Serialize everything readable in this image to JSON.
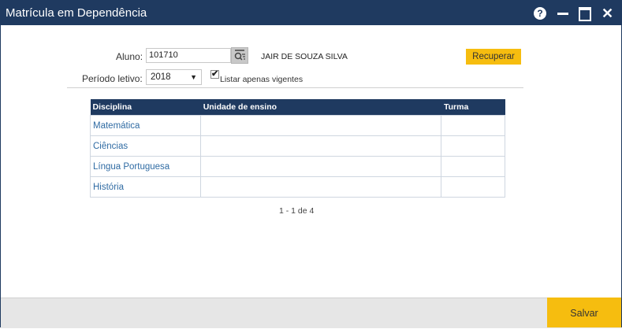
{
  "window": {
    "title": "Matrícula em Dependência",
    "controls": {
      "help": "?",
      "close": "✕"
    }
  },
  "form": {
    "aluno_label": "Aluno:",
    "aluno_value": "101710",
    "student_name": "JAIR DE SOUZA SILVA",
    "recuperar_label": "Recuperar",
    "periodo_label": "Período letivo:",
    "periodo_value": "2018",
    "listar_checked": true,
    "listar_label": "Listar apenas vigentes"
  },
  "table": {
    "headers": [
      "Disciplina",
      "Unidade de ensino",
      "Turma"
    ],
    "rows": [
      {
        "disciplina": "Matemática",
        "unidade": "",
        "turma": ""
      },
      {
        "disciplina": "Ciências",
        "unidade": "",
        "turma": ""
      },
      {
        "disciplina": "Língua Portuguesa",
        "unidade": "",
        "turma": ""
      },
      {
        "disciplina": "História",
        "unidade": "",
        "turma": ""
      }
    ]
  },
  "pager": {
    "text": "1 - 1 de 4"
  },
  "footer": {
    "salvar_label": "Salvar"
  },
  "colors": {
    "titlebar": "#1f3a60",
    "accent": "#f6bd0f",
    "link": "#2f6ba3"
  }
}
